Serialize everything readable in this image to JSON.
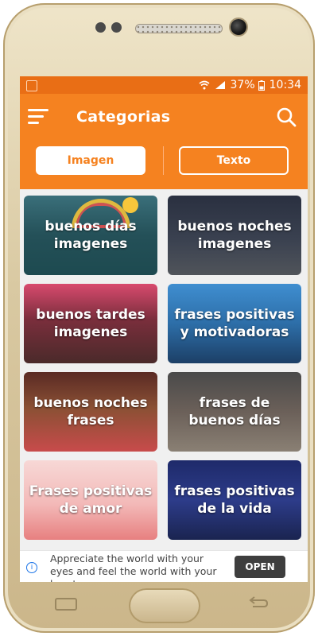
{
  "status_bar": {
    "battery": "37%",
    "time": "10:34",
    "icons": [
      "wifi-icon",
      "signal-icon",
      "battery-icon",
      "notification-icon"
    ]
  },
  "app_bar": {
    "title": "Categorias",
    "icons": {
      "menu": "menu-icon",
      "search": "search-icon"
    }
  },
  "tabs": [
    {
      "label": "Imagen",
      "active": true
    },
    {
      "label": "Texto",
      "active": false
    }
  ],
  "categories": [
    {
      "label": "buenos días imagenes"
    },
    {
      "label": "buenos noches imagenes"
    },
    {
      "label": "buenos tardes imagenes"
    },
    {
      "label": "frases positivas y motivadoras"
    },
    {
      "label": "buenos noches frases"
    },
    {
      "label": "frases de buenos días"
    },
    {
      "label": "Frases positivas de amor"
    },
    {
      "label": "frases positivas de la vida"
    }
  ],
  "ad": {
    "text": "Appreciate the world with your eyes and feel the world with your heart",
    "button": "OPEN",
    "icon": "info-icon"
  },
  "colors": {
    "accent": "#f58220",
    "status_bar": "#e96e15"
  }
}
